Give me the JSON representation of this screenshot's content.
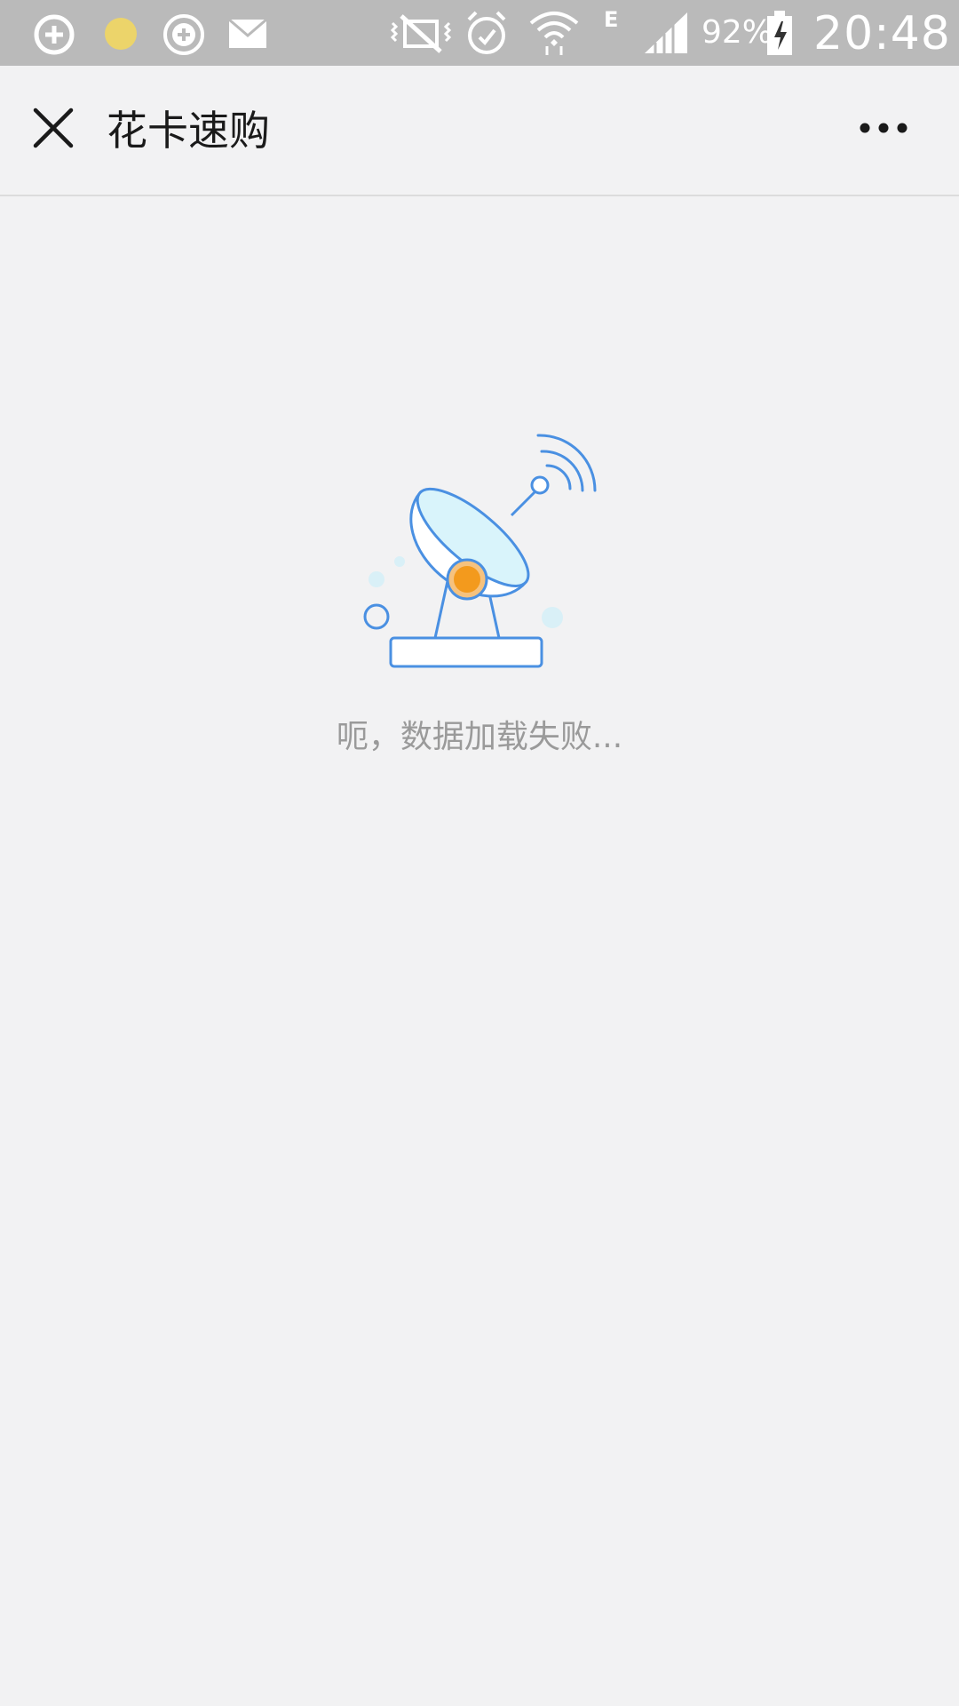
{
  "status_bar": {
    "battery_percent": "92%",
    "time": "20:48",
    "network_type": "E",
    "left_icons": [
      "app-notification-icon",
      "yellow-dot-icon",
      "add-circle-icon",
      "mail-icon"
    ],
    "right_icons": [
      "vibrate-mute-icon",
      "alarm-clock-icon",
      "wifi-icon",
      "signal-icon",
      "battery-charging-icon"
    ]
  },
  "title_bar": {
    "title": "花卡速购",
    "close_icon": "close-icon",
    "more_icon": "more-dots-icon"
  },
  "main": {
    "illustration": "satellite-dish-icon",
    "error_message": "呃，数据加载失败..."
  },
  "colors": {
    "status_bar_bg": "#bababa",
    "page_bg": "#f2f2f3",
    "illustration_blue": "#4a90e2",
    "illustration_orange": "#f39a1d",
    "message_gray": "#9a9a9a"
  }
}
